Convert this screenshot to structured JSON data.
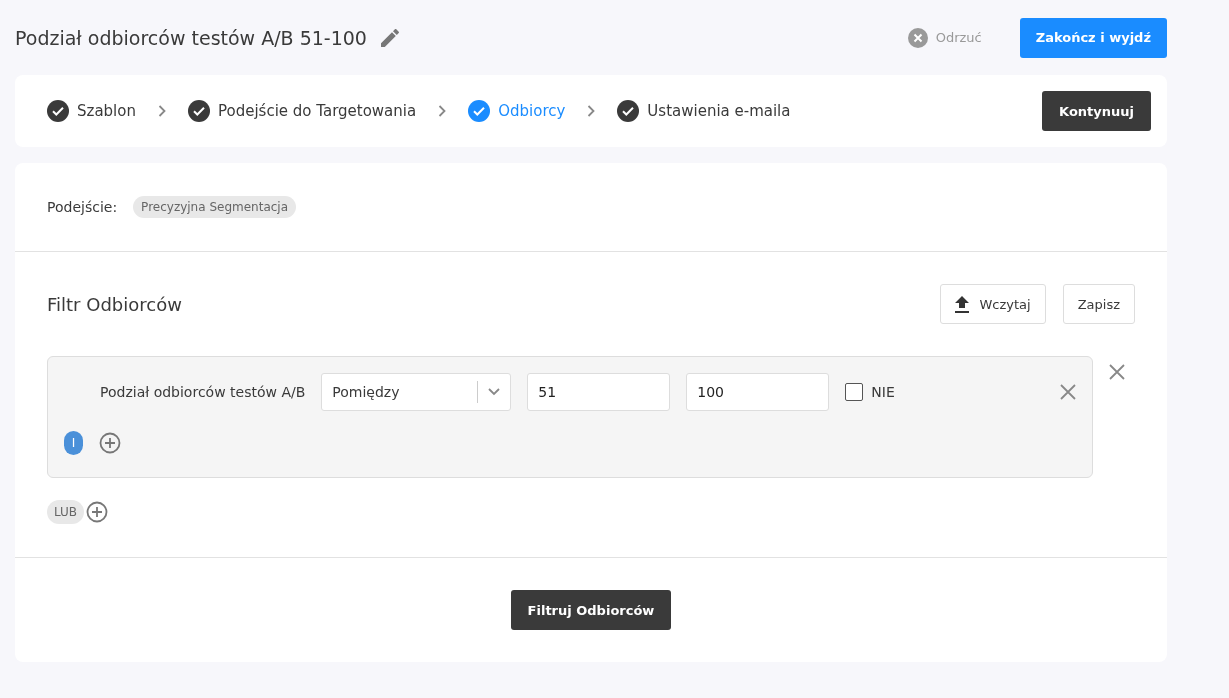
{
  "header": {
    "title": "Podział odbiorców testów A/B 51-100",
    "discard": "Odrzuć",
    "finish": "Zakończ i wyjdź"
  },
  "steps": [
    {
      "label": "Szablon",
      "done": true,
      "selected": false
    },
    {
      "label": "Podejście do Targetowania",
      "done": true,
      "selected": false
    },
    {
      "label": "Odbiorcy",
      "done": true,
      "selected": true
    },
    {
      "label": "Ustawienia e-maila",
      "done": true,
      "selected": false
    }
  ],
  "continue_button": "Kontynuuj",
  "approach": {
    "label": "Podejście:",
    "value": "Precyzyjna Segmentacja"
  },
  "filter": {
    "title": "Filtr Odbiorców",
    "load": "Wczytaj",
    "save": "Zapisz",
    "groups": [
      {
        "conditions": [
          {
            "field": "Podział odbiorców testów A/B",
            "operator": "Pomiędzy",
            "from": "51",
            "to": "100",
            "negate_label": "NIE",
            "negated": false
          }
        ],
        "and_label": "I"
      }
    ],
    "or_label": "LUB",
    "apply": "Filtruj Odbiorców"
  }
}
